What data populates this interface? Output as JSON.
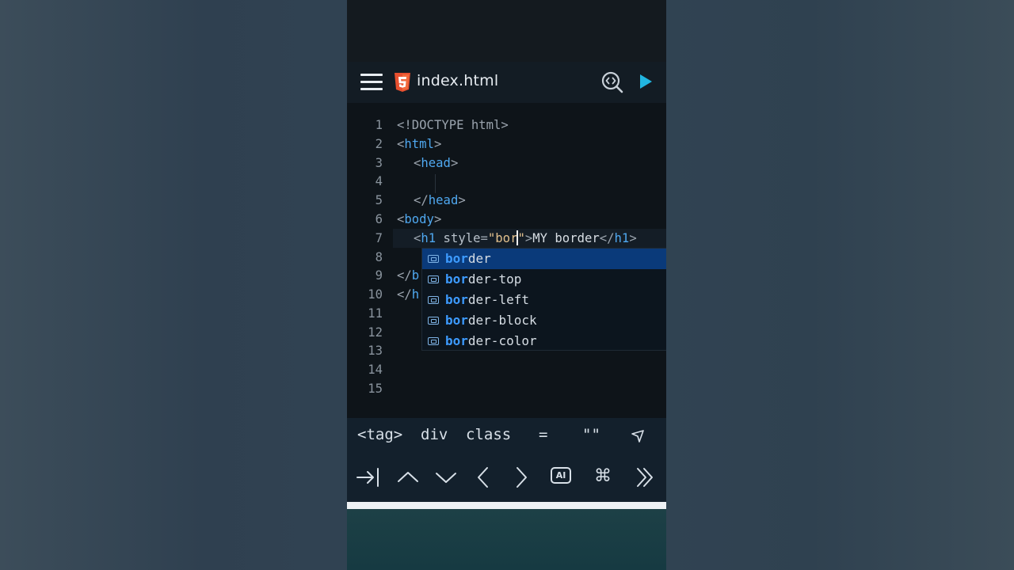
{
  "header": {
    "file_name": "index.html",
    "menu_icon": "hamburger-menu-icon",
    "file_type_icon": "html5-icon",
    "preview_icon": "code-preview-icon",
    "run_icon": "play-icon"
  },
  "editor": {
    "line_numbers": [
      "1",
      "2",
      "3",
      "4",
      "5",
      "6",
      "7",
      "8",
      "9",
      "10",
      "11",
      "12",
      "13",
      "14",
      "15"
    ],
    "lines": {
      "l1": "<!DOCTYPE html>",
      "l2_open": "<",
      "l2_tag": "html",
      "l2_close": ">",
      "l3_open": "<",
      "l3_tag": "head",
      "l3_close": ">",
      "l5_open": "</",
      "l5_tag": "head",
      "l5_close": ">",
      "l6_open": "<",
      "l6_tag": "body",
      "l6_close": ">",
      "l7_open": "<",
      "l7_tag": "h1",
      "l7_attr": " style",
      "l7_eq": "=",
      "l7_str_before": "\"bor",
      "l7_str_after": "\"",
      "l7_gt": ">",
      "l7_text": "MY border",
      "l7_end_open": "</",
      "l7_end_tag": "h1",
      "l7_end_close": ">",
      "l9_open": "</",
      "l9_tag": "b",
      "l10_open": "</",
      "l10_tag": "h"
    }
  },
  "autocomplete": {
    "typed": "bor",
    "items": [
      {
        "prefix": "bor",
        "rest": "der",
        "icon": "property-icon"
      },
      {
        "prefix": "bor",
        "rest": "der-top",
        "icon": "property-icon"
      },
      {
        "prefix": "bor",
        "rest": "der-left",
        "icon": "property-icon"
      },
      {
        "prefix": "bor",
        "rest": "der-block",
        "icon": "property-icon"
      },
      {
        "prefix": "bor",
        "rest": "der-color",
        "icon": "property-icon"
      }
    ],
    "selected_index": 0
  },
  "symbol_bar": {
    "items": [
      "<tag>",
      "div",
      "class",
      "=",
      "\"\""
    ],
    "send_icon": "send-arrow-icon"
  },
  "key_bar": {
    "ai_label": "AI",
    "cmd_label": "⌘",
    "icons": [
      "tab-icon",
      "arrow-up-icon",
      "arrow-down-icon",
      "arrow-left-icon",
      "arrow-right-icon",
      "ai-icon",
      "command-icon",
      "double-chevron-right-icon"
    ]
  },
  "colors": {
    "tag": "#4fa8f0",
    "string": "#e2c08d",
    "selection": "#0a3a7a",
    "match": "#3d9bff",
    "run": "#21b5e0",
    "html5": "#e8502f"
  }
}
